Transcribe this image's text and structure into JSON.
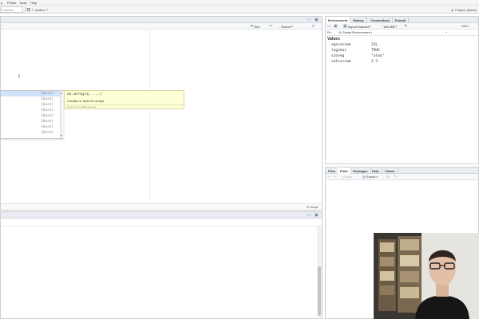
{
  "menubar": {
    "items": [
      "p",
      "Profile",
      "Tools",
      "Help"
    ]
  },
  "toolbar": {
    "address_value": "Function",
    "addins_label": "Addins",
    "project_label": "Project: (None)"
  },
  "editor": {
    "run_label": "Run",
    "source_label": "Source",
    "status_right": "R Script"
  },
  "completion": {
    "items": [
      {
        "name": "",
        "pkg": "{base}"
      },
      {
        "name": "",
        "pkg": "{base}"
      },
      {
        "name": "",
        "pkg": "{base}"
      },
      {
        "name": "",
        "pkg": "{base}"
      },
      {
        "name": "",
        "pkg": "{base}"
      },
      {
        "name": "",
        "pkg": "{base}"
      },
      {
        "name": "",
        "pkg": "{base}"
      },
      {
        "name": "",
        "pkg": "{base}"
      }
    ],
    "help_signature": "as.array(x, ...)",
    "help_description": "Creates or tests for arrays.",
    "help_hint": "Press F1 for additional help"
  },
  "environment": {
    "tabs": [
      "Environment",
      "History",
      "Connections",
      "Tutorial"
    ],
    "import_label": "Import Dataset",
    "memory_label": "168 MiB",
    "list_label": "List",
    "lang_label": "R",
    "scope_label": "Global Environment",
    "section_label": "Values",
    "values": [
      {
        "name": "egeszszam",
        "value": "23L"
      },
      {
        "name": "logikai",
        "value": "TRUE"
      },
      {
        "name": "szoveg",
        "value": "\"alma\""
      },
      {
        "name": "valosszam",
        "value": "2.3"
      }
    ]
  },
  "files_pane": {
    "tabs": [
      "Files",
      "Plots",
      "Packages",
      "Help",
      "Viewer"
    ],
    "zoom_label": "Zoom",
    "export_label": "Export"
  },
  "colors": {
    "pane_header": "#e9edf2",
    "selection": "#cfe4fb",
    "help_bg": "#ffffd6"
  }
}
